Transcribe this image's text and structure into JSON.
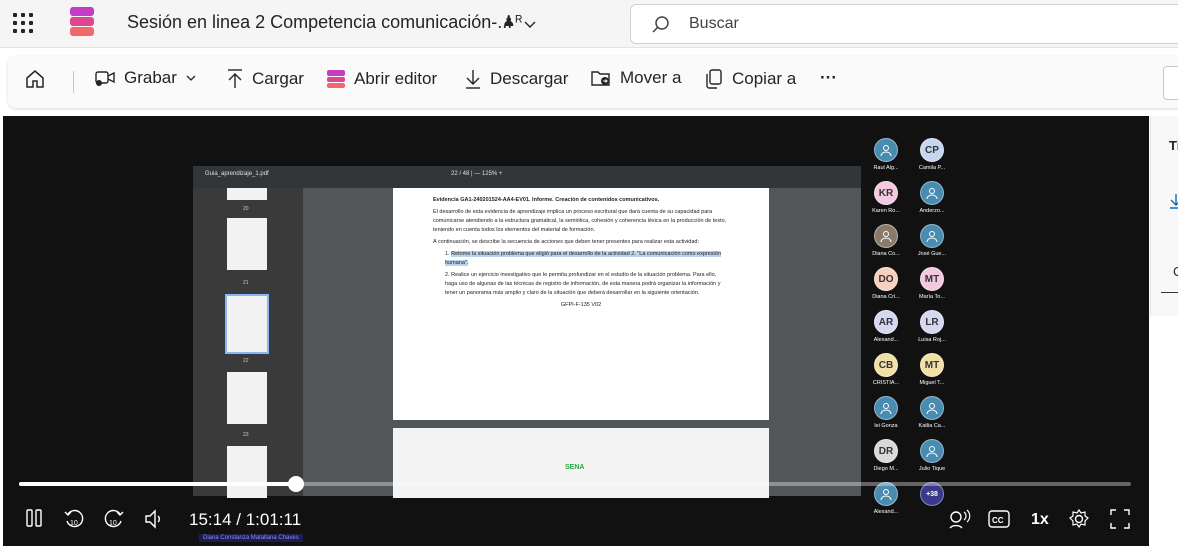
{
  "titlebar": {
    "title": "Sesión en linea 2 Competencia comunicación-...",
    "search_placeholder": "Buscar"
  },
  "toolbar": {
    "record": "Grabar",
    "upload": "Cargar",
    "open_editor": "Abrir editor",
    "download": "Descargar",
    "move_to": "Mover a",
    "copy_to": "Copiar a",
    "more": "···"
  },
  "pdf": {
    "filename": "Guia_aprendizaje_1.pdf",
    "page_indicator": "22 / 48 | — 125% +",
    "thumb_labels": [
      "20",
      "21",
      "22",
      "23"
    ],
    "heading": "Evidencia GA1-240201524-AA4-EV01. Informe. Creación de contenidos comunicativos.",
    "para1": "El desarrollo de esta evidencia de aprendizaje implica un proceso escritural que dará cuenta de su capacidad para comunicarse atendiendo a la estructura gramatical, la semiótica, cohesión y coherencia léxica en la producción de texto, teniendo en cuenta todos los elementos del material de formación.",
    "para2": "A continuación, se describe la secuencia de acciones que deben tener presentes para realizar esta actividad:",
    "item1": "Retome la situación problema que eligió para el desarrollo de la actividad 2. \"La comunicación como expresión humana\".",
    "item2": "Realice un ejercicio investigativo que le permita profundizar en el estudio de la situación problema. Para ello, haga uso de algunas de las técnicas de registro de información, de esta manera podrá organizar la información y tener un panorama más amplio y claro de la situación que deberá desarrollar en la siguiente orientación.",
    "footer_code": "GFPI-F-135 V02",
    "logo_text": "SENA"
  },
  "participants": [
    {
      "initials": "",
      "name": "Raul Alg...",
      "color": "#4a8bb0"
    },
    {
      "initials": "CP",
      "name": "Camila P...",
      "color": "#c7d6f0"
    },
    {
      "initials": "KR",
      "name": "Karen Ro...",
      "color": "#f2c9e0"
    },
    {
      "initials": "",
      "name": "Anderzo...",
      "color": "#4a8bb0"
    },
    {
      "initials": "",
      "name": "Diana Co...",
      "color": "#8a7a6a"
    },
    {
      "initials": "",
      "name": "José Gue...",
      "color": "#4a8bb0"
    },
    {
      "initials": "DO",
      "name": "Diana Cri...",
      "color": "#f6d1bf"
    },
    {
      "initials": "MT",
      "name": "María To...",
      "color": "#f2c9e0"
    },
    {
      "initials": "AR",
      "name": "Alexand...",
      "color": "#d6d8f2"
    },
    {
      "initials": "LR",
      "name": "Luisa Roj...",
      "color": "#d6d8f2"
    },
    {
      "initials": "CB",
      "name": "CRISTIA...",
      "color": "#f2dfa6"
    },
    {
      "initials": "MT",
      "name": "Miguel T...",
      "color": "#f2dfa6"
    },
    {
      "initials": "",
      "name": "lei Gonza",
      "color": "#4a8bb0"
    },
    {
      "initials": "",
      "name": "Katlia Ca...",
      "color": "#4a8bb0"
    },
    {
      "initials": "DR",
      "name": "Diego M...",
      "color": "#d9d9d9"
    },
    {
      "initials": "",
      "name": "Julio Tique",
      "color": "#4a8bb0"
    },
    {
      "initials": "",
      "name": "Alexand...",
      "color": "#4a8bb0"
    },
    {
      "initials": "+38",
      "name": "",
      "color": "#3b3a8a"
    }
  ],
  "player": {
    "time": "15:14 / 1:01:11",
    "progress": 0.249,
    "speed": "1x",
    "speaker_name": "Diana Constanza Matallana Chaves"
  },
  "sidepanel": {
    "title_partial": "Ti",
    "c_partial": "C"
  }
}
